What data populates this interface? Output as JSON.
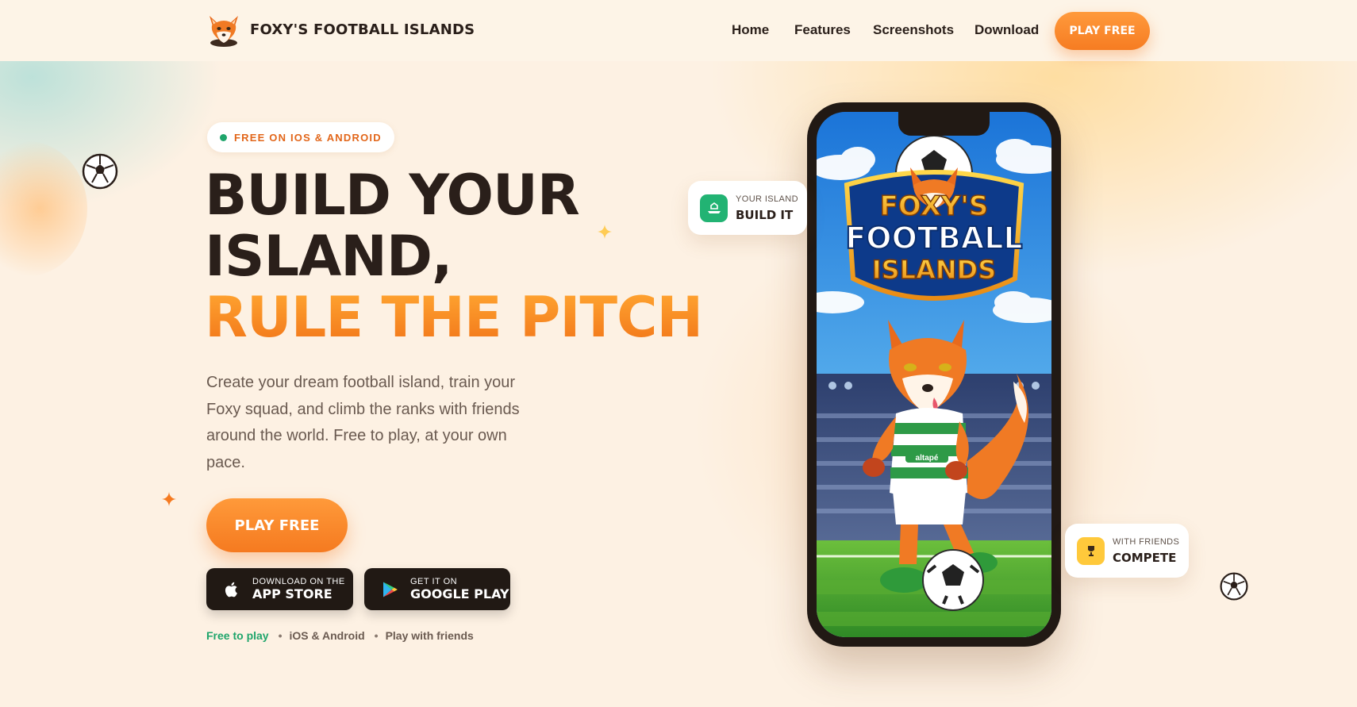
{
  "brand": {
    "name": "FOXY'S FOOTBALL ISLANDS"
  },
  "nav": {
    "links": [
      {
        "label": "Home"
      },
      {
        "label": "Features"
      },
      {
        "label": "Screenshots"
      },
      {
        "label": "Download"
      }
    ],
    "cta": "PLAY FREE"
  },
  "hero": {
    "badge": "FREE ON IOS & ANDROID",
    "title_line1": "BUILD YOUR",
    "title_line2": "ISLAND,",
    "title_line3": "RULE THE PITCH",
    "lede": "Create your dream football island, train your Foxy squad, and climb the ranks with friends around the world. Free to play, at your own pace.",
    "play_button": "PLAY FREE",
    "app_store": {
      "small": "DOWNLOAD ON THE",
      "big": "APP STORE"
    },
    "google_play": {
      "small": "GET IT ON",
      "big": "GOOGLE PLAY"
    },
    "meta": [
      "Free to play",
      "iOS & Android",
      "Play with friends"
    ]
  },
  "phone": {
    "logo_line1": "FOXY'S",
    "logo_line2": "FOOTBALL",
    "logo_line3": "ISLANDS",
    "jersey_text": "altapé"
  },
  "cards": {
    "build": {
      "small": "YOUR ISLAND",
      "big": "BUILD IT"
    },
    "compete": {
      "small": "WITH FRIENDS",
      "big": "COMPETE"
    }
  },
  "colors": {
    "accent": "#f57a20",
    "dark": "#211914",
    "green": "#1fa56b",
    "background": "#fdf1e3"
  }
}
